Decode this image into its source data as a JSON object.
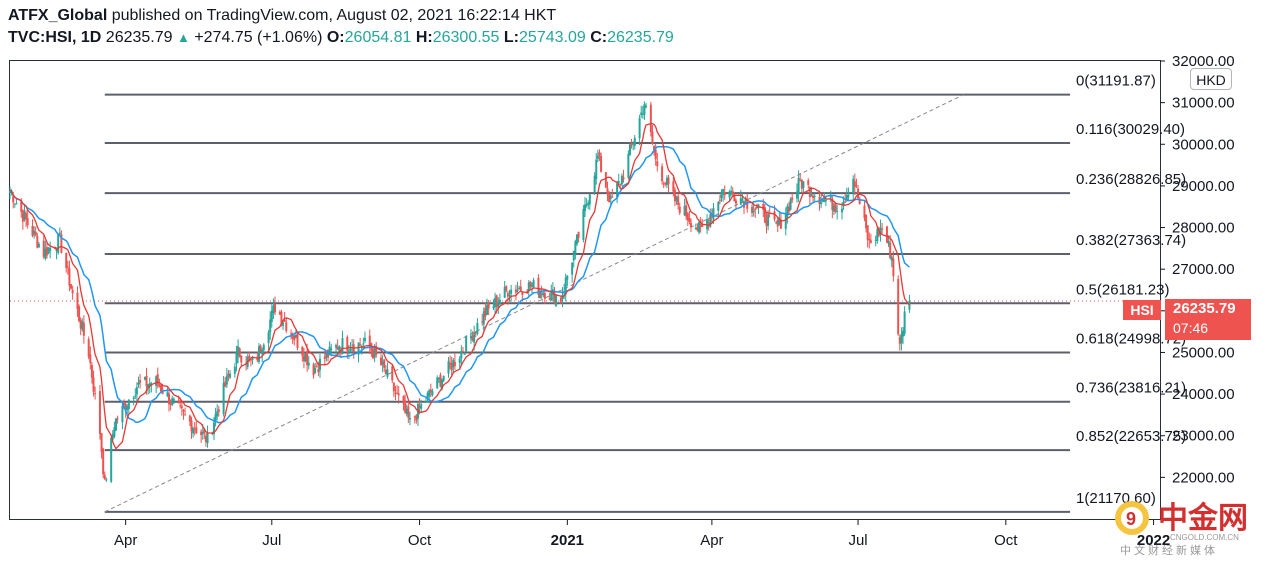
{
  "header": {
    "publisher": "ATFX_Global",
    "published_text": "published on TradingView.com, August 02, 2021 16:22:14 HKT",
    "symbol": "TVC:HSI, 1D",
    "last": "26235.79",
    "change": "+274.75 (+1.06%)",
    "o_label": "O:",
    "o_value": "26054.81",
    "h_label": "H:",
    "h_value": "26300.55",
    "l_label": "L:",
    "l_value": "25743.09",
    "c_label": "C:",
    "c_value": "26235.79"
  },
  "currency": "HKD",
  "price_tag": {
    "name": "HSI",
    "price": "26235.79",
    "countdown": "07:46"
  },
  "watermark": {
    "logo": "中金网",
    "url": "CNGOLD.COM.CN",
    "tagline": "中文财经新媒体"
  },
  "colors": {
    "up": "#26a69a",
    "down": "#ef5350",
    "ma_fast": "#e53935",
    "ma_slow": "#2196f3",
    "fib": "#5d606b",
    "trend": "#888888"
  },
  "chart_data": {
    "type": "candlestick",
    "y_axis": {
      "min": 21000,
      "max": 32000,
      "ticks": [
        22000,
        23000,
        24000,
        25000,
        26000,
        27000,
        28000,
        29000,
        30000,
        31000,
        32000
      ],
      "tick_labels": [
        "22000.00",
        "23000.00",
        "24000.00",
        "25000.00",
        "26000.00",
        "27000.00",
        "28000.00",
        "29000.00",
        "30000.00",
        "31000.00",
        "32000.00"
      ]
    },
    "x_axis": {
      "labels": [
        "Apr",
        "Jul",
        "Oct",
        "2021",
        "Apr",
        "Jul",
        "Oct",
        "2022"
      ],
      "label_dates": [
        "2020-04-01",
        "2020-07-01",
        "2020-10-01",
        "2021-01-01",
        "2021-04-01",
        "2021-07-01",
        "2021-10-01",
        "2022-01-01"
      ],
      "bold": [
        "2021",
        "2022"
      ],
      "start": "2020-01-20",
      "end": "2022-01-05"
    },
    "series_anchors": [
      [
        "2020-01-20",
        28900
      ],
      [
        "2020-01-28",
        28300
      ],
      [
        "2020-02-10",
        27400
      ],
      [
        "2020-02-20",
        27700
      ],
      [
        "2020-02-28",
        26400
      ],
      [
        "2020-03-09",
        25000
      ],
      [
        "2020-03-16",
        23100
      ],
      [
        "2020-03-19",
        21800
      ],
      [
        "2020-03-25",
        23300
      ],
      [
        "2020-04-08",
        24200
      ],
      [
        "2020-04-20",
        24300
      ],
      [
        "2020-05-04",
        23600
      ],
      [
        "2020-05-22",
        22900
      ],
      [
        "2020-06-02",
        24200
      ],
      [
        "2020-06-10",
        25000
      ],
      [
        "2020-06-20",
        24700
      ],
      [
        "2020-07-03",
        26100
      ],
      [
        "2020-07-13",
        25500
      ],
      [
        "2020-07-27",
        24600
      ],
      [
        "2020-08-12",
        25200
      ],
      [
        "2020-08-30",
        25200
      ],
      [
        "2020-09-10",
        24500
      ],
      [
        "2020-09-25",
        23300
      ],
      [
        "2020-10-09",
        24100
      ],
      [
        "2020-10-25",
        24900
      ],
      [
        "2020-11-10",
        25900
      ],
      [
        "2020-11-25",
        26500
      ],
      [
        "2020-12-10",
        26600
      ],
      [
        "2020-12-28",
        26300
      ],
      [
        "2021-01-08",
        27800
      ],
      [
        "2021-01-20",
        29700
      ],
      [
        "2021-01-28",
        28600
      ],
      [
        "2021-02-05",
        29300
      ],
      [
        "2021-02-18",
        31000
      ],
      [
        "2021-02-25",
        29600
      ],
      [
        "2021-03-08",
        28700
      ],
      [
        "2021-03-25",
        27900
      ],
      [
        "2021-04-08",
        28900
      ],
      [
        "2021-04-20",
        28700
      ],
      [
        "2021-05-12",
        28000
      ],
      [
        "2021-05-26",
        29100
      ],
      [
        "2021-06-08",
        28700
      ],
      [
        "2021-06-20",
        28500
      ],
      [
        "2021-06-28",
        29200
      ],
      [
        "2021-07-08",
        27600
      ],
      [
        "2021-07-16",
        28000
      ],
      [
        "2021-07-22",
        27300
      ],
      [
        "2021-07-27",
        25100
      ],
      [
        "2021-07-30",
        25900
      ],
      [
        "2021-08-02",
        26235
      ]
    ],
    "ma_fast_label": "",
    "ma_slow_label": "",
    "fibonacci": {
      "start": {
        "date": "2020-03-19",
        "price": 21170.6
      },
      "end": {
        "date": "2022-01-01",
        "price": 31191.87
      },
      "levels": [
        {
          "ratio": "0",
          "price": "31191.87",
          "value": 31191.87
        },
        {
          "ratio": "0.116",
          "price": "30029.40",
          "value": 30029.4
        },
        {
          "ratio": "0.236",
          "price": "28826.85",
          "value": 28826.85
        },
        {
          "ratio": "0.382",
          "price": "27363.74",
          "value": 27363.74
        },
        {
          "ratio": "0.5",
          "price": "26181.23",
          "value": 26181.23
        },
        {
          "ratio": "0.618",
          "price": "24998.72",
          "value": 24998.72
        },
        {
          "ratio": "0.736",
          "price": "23816.21",
          "value": 23816.21
        },
        {
          "ratio": "0.852",
          "price": "22653.75",
          "value": 22653.75
        },
        {
          "ratio": "1",
          "price": "21170.60",
          "value": 21170.6
        }
      ],
      "line_start_date": "2020-03-19",
      "line_end_date": "2021-11-10"
    },
    "last_price": 26235.79
  }
}
